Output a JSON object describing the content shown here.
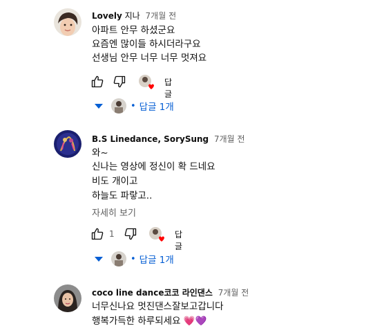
{
  "comments": [
    {
      "author": "Lovely",
      "author_suffix": "지나",
      "time": "7개월 전",
      "lines": [
        "아파트 안무 하셨군요",
        " 요즘엔 많이들 하시더라구요",
        " 선생님  안무 너무 너무 멋져요"
      ],
      "like_count": "",
      "reply_label": "답글",
      "replies_label": "답글 1개"
    },
    {
      "author": "B.S Linedance, SorySung",
      "author_suffix": "",
      "time": "7개월 전",
      "lines": [
        "와~",
        "신나는 영상에 정신이 확 드네요",
        "비도 개이고",
        "하늘도 파랗고.."
      ],
      "read_more": "자세히 보기",
      "like_count": "1",
      "reply_label": "답글",
      "replies_label": "답글 1개"
    },
    {
      "author": "coco line dance코코 라인댄스",
      "author_suffix": "",
      "time": "7개월 전",
      "lines": [
        "너무신나요  멋진댄스잘보고갑니다",
        "행복가득한 하루되세요 💗💜"
      ]
    }
  ],
  "colors": {
    "link_blue": "#065fd4",
    "meta_gray": "#606060",
    "heart_red": "#ff0000"
  }
}
